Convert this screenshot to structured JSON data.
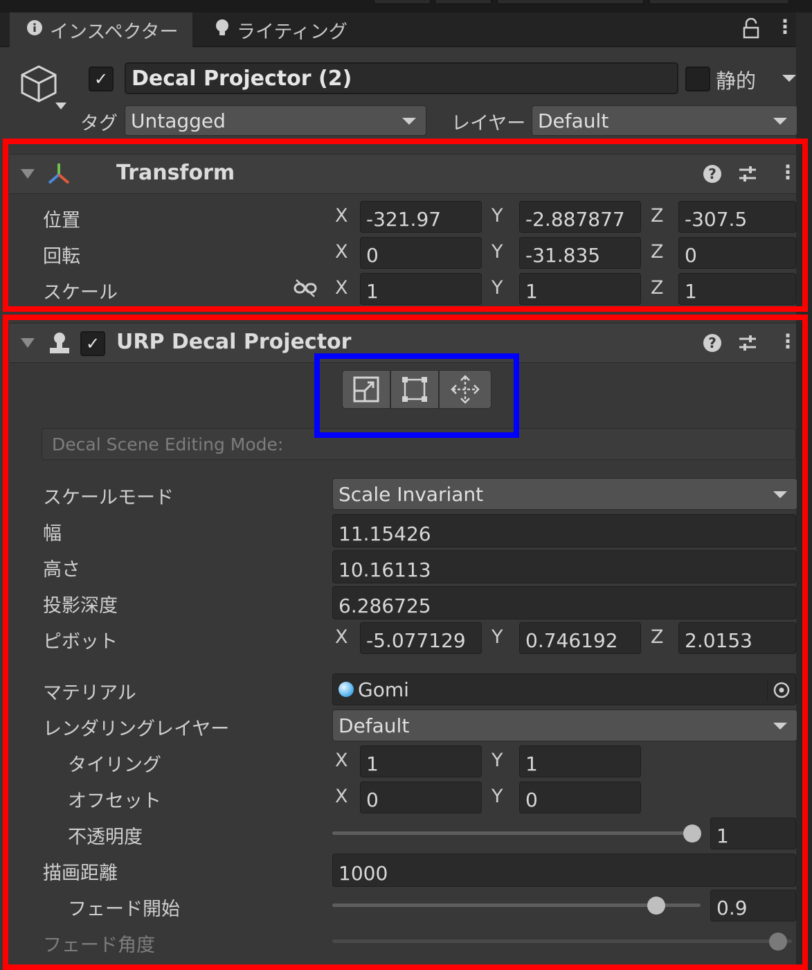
{
  "tabs": [
    {
      "label": "インスペクター",
      "icon": "info-icon",
      "active": true
    },
    {
      "label": "ライティング",
      "icon": "lightbulb-icon",
      "active": false
    }
  ],
  "header": {
    "object_name": "Decal Projector (2)",
    "active_checked": true,
    "static_label": "静的",
    "tag_label": "タグ",
    "tag_value": "Untagged",
    "layer_label": "レイヤー",
    "layer_value": "Default"
  },
  "transform": {
    "title": "Transform",
    "position": {
      "label": "位置",
      "x": "-321.97",
      "y": "-2.887877",
      "z": "-307.5"
    },
    "rotation": {
      "label": "回転",
      "x": "0",
      "y": "-31.835",
      "z": "0"
    },
    "scale": {
      "label": "スケール",
      "x": "1",
      "y": "1",
      "z": "1"
    }
  },
  "axes": {
    "x": "X",
    "y": "Y",
    "z": "Z"
  },
  "decal": {
    "title": "URP Decal Projector",
    "enabled": true,
    "editing_mode_label": "Decal Scene Editing Mode:",
    "scale_mode": {
      "label": "スケールモード",
      "value": "Scale Invariant"
    },
    "width": {
      "label": "幅",
      "value": "11.15426"
    },
    "height": {
      "label": "高さ",
      "value": "10.16113"
    },
    "projection_depth": {
      "label": "投影深度",
      "value": "6.286725"
    },
    "pivot": {
      "label": "ピボット",
      "x": "-5.077129",
      "y": "0.746192",
      "z": "2.0153"
    },
    "material": {
      "label": "マテリアル",
      "value": "Gomi"
    },
    "rendering_layer": {
      "label": "レンダリングレイヤー",
      "value": "Default"
    },
    "tiling": {
      "label": "タイリング",
      "x": "1",
      "y": "1"
    },
    "offset": {
      "label": "オフセット",
      "x": "0",
      "y": "0"
    },
    "opacity": {
      "label": "不透明度",
      "value": "1",
      "fraction": 1.0
    },
    "draw_distance": {
      "label": "描画距離",
      "value": "1000"
    },
    "fade_start": {
      "label": "フェード開始",
      "value": "0.9",
      "fraction": 0.9
    },
    "fade_angle": {
      "label": "フェード角度",
      "fraction": 1.0
    }
  },
  "colors": {
    "highlight_red": "#ff0000",
    "highlight_blue": "#0000ff",
    "panel_bg": "#383838"
  }
}
